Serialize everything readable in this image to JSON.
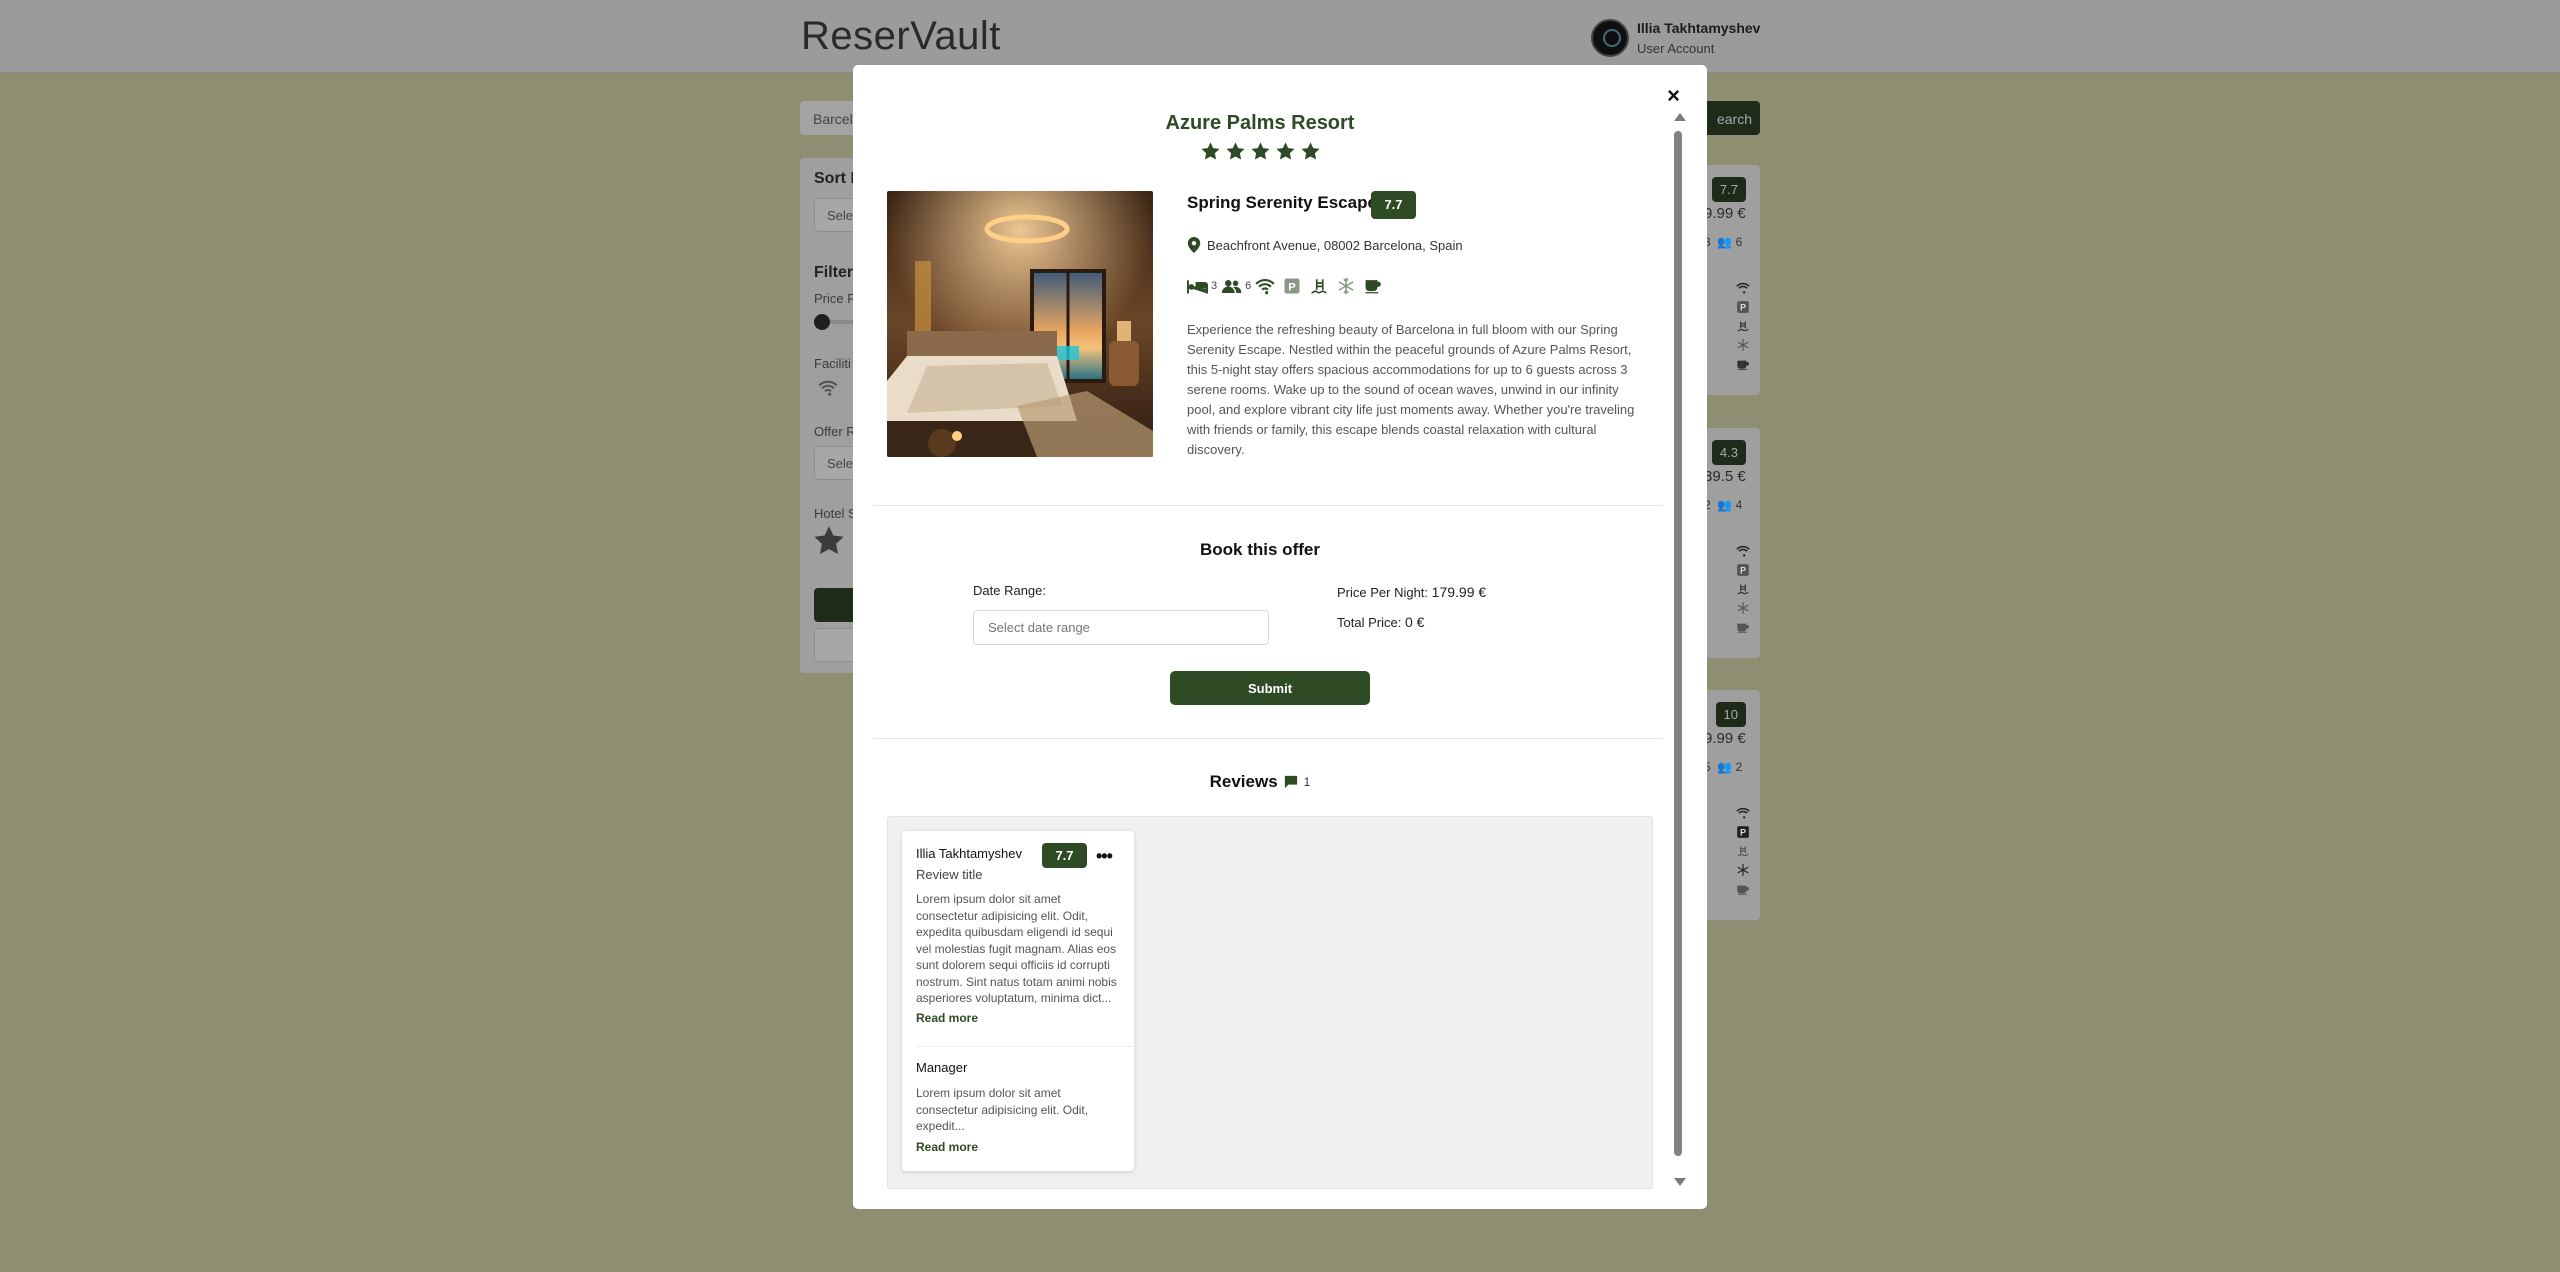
{
  "app": {
    "brand": "ReserVault",
    "user": {
      "name": "Illia Takhtamyshev",
      "role": "User Account"
    }
  },
  "background": {
    "search_value": "Barcelo",
    "search_button": "earch",
    "sidebar": {
      "sort_title": "Sort B",
      "sort_select": "Sele",
      "filter_title": "Filter",
      "price_label": "Price R",
      "facilities_label": "Faciliti",
      "offer_label": "Offer R",
      "offer_select": "Sele",
      "stars_label": "Hotel S"
    },
    "cards": [
      {
        "rating": "7.7",
        "price": "9.99 €",
        "rooms": "3",
        "guests": "6"
      },
      {
        "rating": "4.3",
        "price": "39.5 €",
        "rooms": "2",
        "guests": "4"
      },
      {
        "rating": "10",
        "price": "9.99 €",
        "rooms": "5",
        "guests": "2"
      }
    ]
  },
  "modal": {
    "close_label": "×",
    "hotel_name": "Azure Palms Resort",
    "hotel_stars": 5,
    "offer": {
      "title": "Spring Serenity Escape",
      "rating": "7.7",
      "address": "Beachfront Avenue, 08002 Barcelona, Spain",
      "rooms": "3",
      "guests": "6",
      "amenity_icons": [
        "bed-icon",
        "guests-icon",
        "wifi-icon",
        "parking-icon",
        "pool-icon",
        "snowflake-icon",
        "coffee-icon"
      ],
      "description": "Experience the refreshing beauty of Barcelona in full bloom with our Spring Serenity Escape. Nestled within the peaceful grounds of Azure Palms Resort, this 5-night stay offers spacious accommodations for up to 6 guests across 3 serene rooms. Wake up to the sound of ocean waves, unwind in our infinity pool, and explore vibrant city life just moments away. Whether you're traveling with friends or family, this escape blends coastal relaxation with cultural discovery."
    },
    "booking": {
      "title": "Book this offer",
      "date_label": "Date Range:",
      "date_placeholder": "Select date range",
      "price_per_night_label": "Price Per Night:",
      "price_per_night": "179.99 €",
      "total_price_label": "Total Price:",
      "total_price": "0 €",
      "submit": "Submit"
    },
    "reviews": {
      "title": "Reviews",
      "count": "1",
      "items": [
        {
          "author": "Illia Takhtamyshev",
          "rating": "7.7",
          "title": "Review title",
          "body": "Lorem ipsum dolor sit amet consectetur adipisicing elit. Odit, expedita quibusdam eligendi id sequi vel molestias fugit magnam. Alias eos sunt dolorem sequi officiis id corrupti nostrum. Sint natus totam animi nobis asperiores voluptatum, minima dict...",
          "read_more": "Read more",
          "reply": {
            "title": "Manager",
            "body": "Lorem ipsum dolor sit amet consectetur adipisicing elit. Odit, expedit...",
            "read_more": "Read more"
          }
        }
      ]
    }
  },
  "colors": {
    "accent": "#2f4b26",
    "overlay_page": "#8e8e73",
    "panel": "#eef0f2"
  }
}
